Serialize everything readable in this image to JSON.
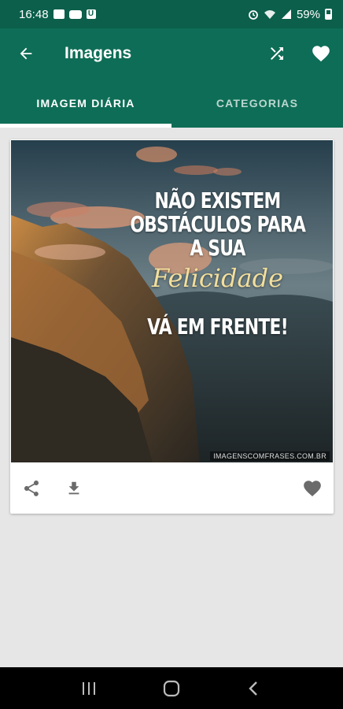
{
  "status": {
    "time": "16:48",
    "battery": "59%"
  },
  "appbar": {
    "title": "Imagens"
  },
  "tabs": [
    {
      "label": "IMAGEM DIÁRIA",
      "active": true
    },
    {
      "label": "CATEGORIAS",
      "active": false
    }
  ],
  "card": {
    "quote_line1": "NÃO EXISTEM",
    "quote_line2": "OBSTÁCULOS PARA",
    "quote_line3": "A SUA",
    "quote_script": "Felicidade",
    "quote_line4": "VÁ EM FRENTE!",
    "watermark": "IMAGENSCOMFRASES.COM.BR"
  },
  "colors": {
    "appbar": "#0e6d56",
    "statusbar": "#0b5f4b",
    "background": "#e6e6e6",
    "icon_gray": "#6b6b6b"
  }
}
